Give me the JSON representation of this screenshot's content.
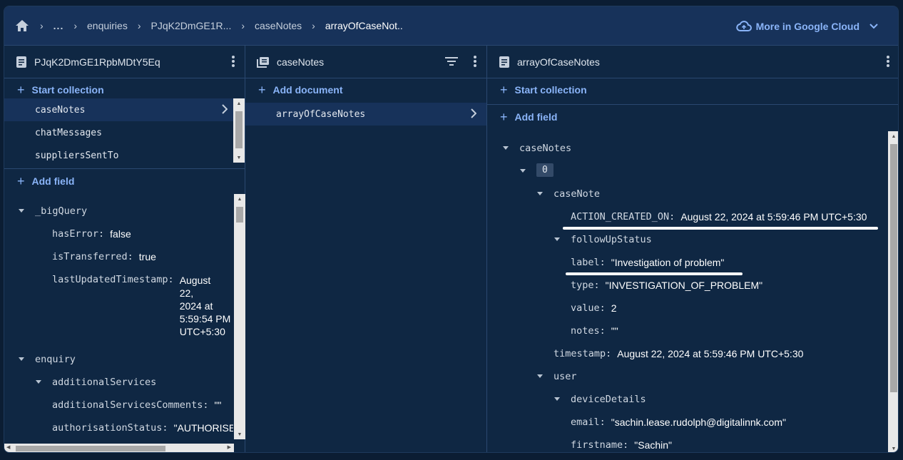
{
  "breadcrumb": {
    "ellipsis": "...",
    "items": [
      "enquiries",
      "PJqK2DmGE1R...",
      "caseNotes",
      "arrayOfCaseNot.."
    ]
  },
  "cloud": {
    "label": "More in Google Cloud"
  },
  "panel1": {
    "title": "PJqK2DmGE1RpbMDtY5Eq",
    "start_collection": "Start collection",
    "collections": [
      "caseNotes",
      "chatMessages",
      "suppliersSentTo"
    ],
    "add_field": "Add field",
    "fields": {
      "bigQuery": "_bigQuery",
      "hasError_k": "hasError:",
      "hasError_v": "false",
      "isTransferred_k": "isTransferred:",
      "isTransferred_v": "true",
      "lastUpdated_k": "lastUpdatedTimestamp:",
      "lastUpdated_v": [
        "August",
        "22,",
        "2024 at",
        "5:59:54 PM",
        "UTC+5:30"
      ],
      "enquiry": "enquiry",
      "additionalServices": "additionalServices",
      "asc_k": "additionalServicesComments:",
      "asc_v": "\"\"",
      "auth_k": "authorisationStatus:",
      "auth_v": "\"AUTHORISE"
    }
  },
  "panel2": {
    "title": "caseNotes",
    "add_document": "Add document",
    "documents": [
      "arrayOfCaseNotes"
    ]
  },
  "panel3": {
    "title": "arrayOfCaseNotes",
    "start_collection": "Start collection",
    "add_field": "Add field",
    "fields": {
      "caseNotes": "caseNotes",
      "index0": "0",
      "caseNote": "caseNote",
      "acted_k": "ACTION_CREATED_ON:",
      "acted_v": "August 22, 2024 at 5:59:46 PM UTC+5:30",
      "followUpStatus": "followUpStatus",
      "label_k": "label:",
      "label_v": "\"Investigation of problem\"",
      "type_k": "type:",
      "type_v": "\"INVESTIGATION_OF_PROBLEM\"",
      "value_k": "value:",
      "value_v": "2",
      "notes_k": "notes:",
      "notes_v": "\"\"",
      "timestamp_k": "timestamp:",
      "timestamp_v": "August 22, 2024 at 5:59:46 PM UTC+5:30",
      "user": "user",
      "deviceDetails": "deviceDetails",
      "email_k": "email:",
      "email_v": "\"sachin.lease.rudolph@digitalinnk.com\"",
      "firstname_k": "firstname:",
      "firstname_v": "\"Sachin\""
    }
  },
  "colors": {
    "accent": "#8ab4f8",
    "bg": "#0f2743",
    "header": "#17325a"
  }
}
